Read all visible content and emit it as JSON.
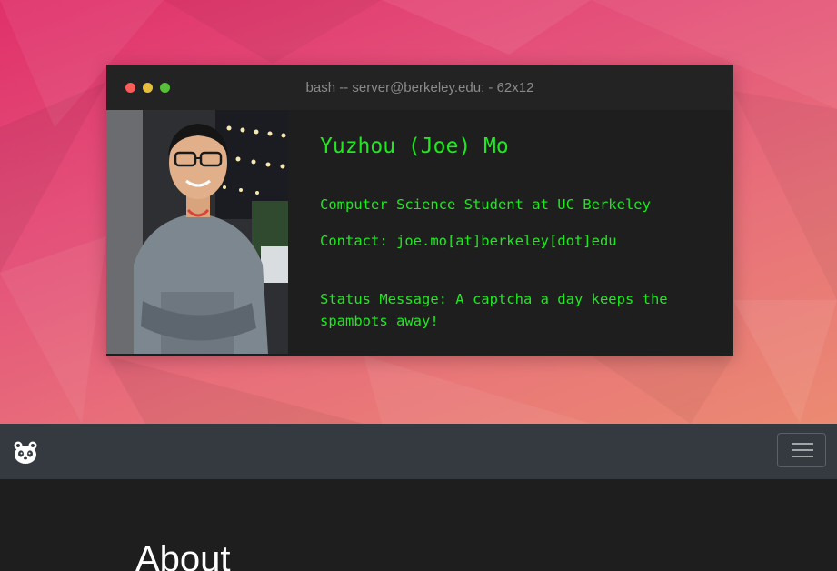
{
  "hero": {
    "terminal": {
      "title": "bash -- server@berkeley.edu: - 62x12",
      "name": "Yuzhou (Joe) Mo",
      "line1": "Computer Science Student at UC Berkeley",
      "line2": "Contact: joe.mo[at]berkeley[dot]edu",
      "line3": "Status Message: A captcha a day keeps the spambots away!",
      "text_color": "#1fe81f",
      "window_buttons": [
        "close",
        "minimize",
        "maximize"
      ]
    }
  },
  "navbar": {
    "brand_icon": "panda-icon",
    "menu_icon": "hamburger-menu-icon"
  },
  "main": {
    "section_title": "About"
  },
  "colors": {
    "hero_gradient": [
      "#e0306a",
      "#eb8a72"
    ],
    "terminal_bg": "#1e1e1e",
    "navbar_bg": "#343a40",
    "page_bg": "#1e1e1e"
  }
}
